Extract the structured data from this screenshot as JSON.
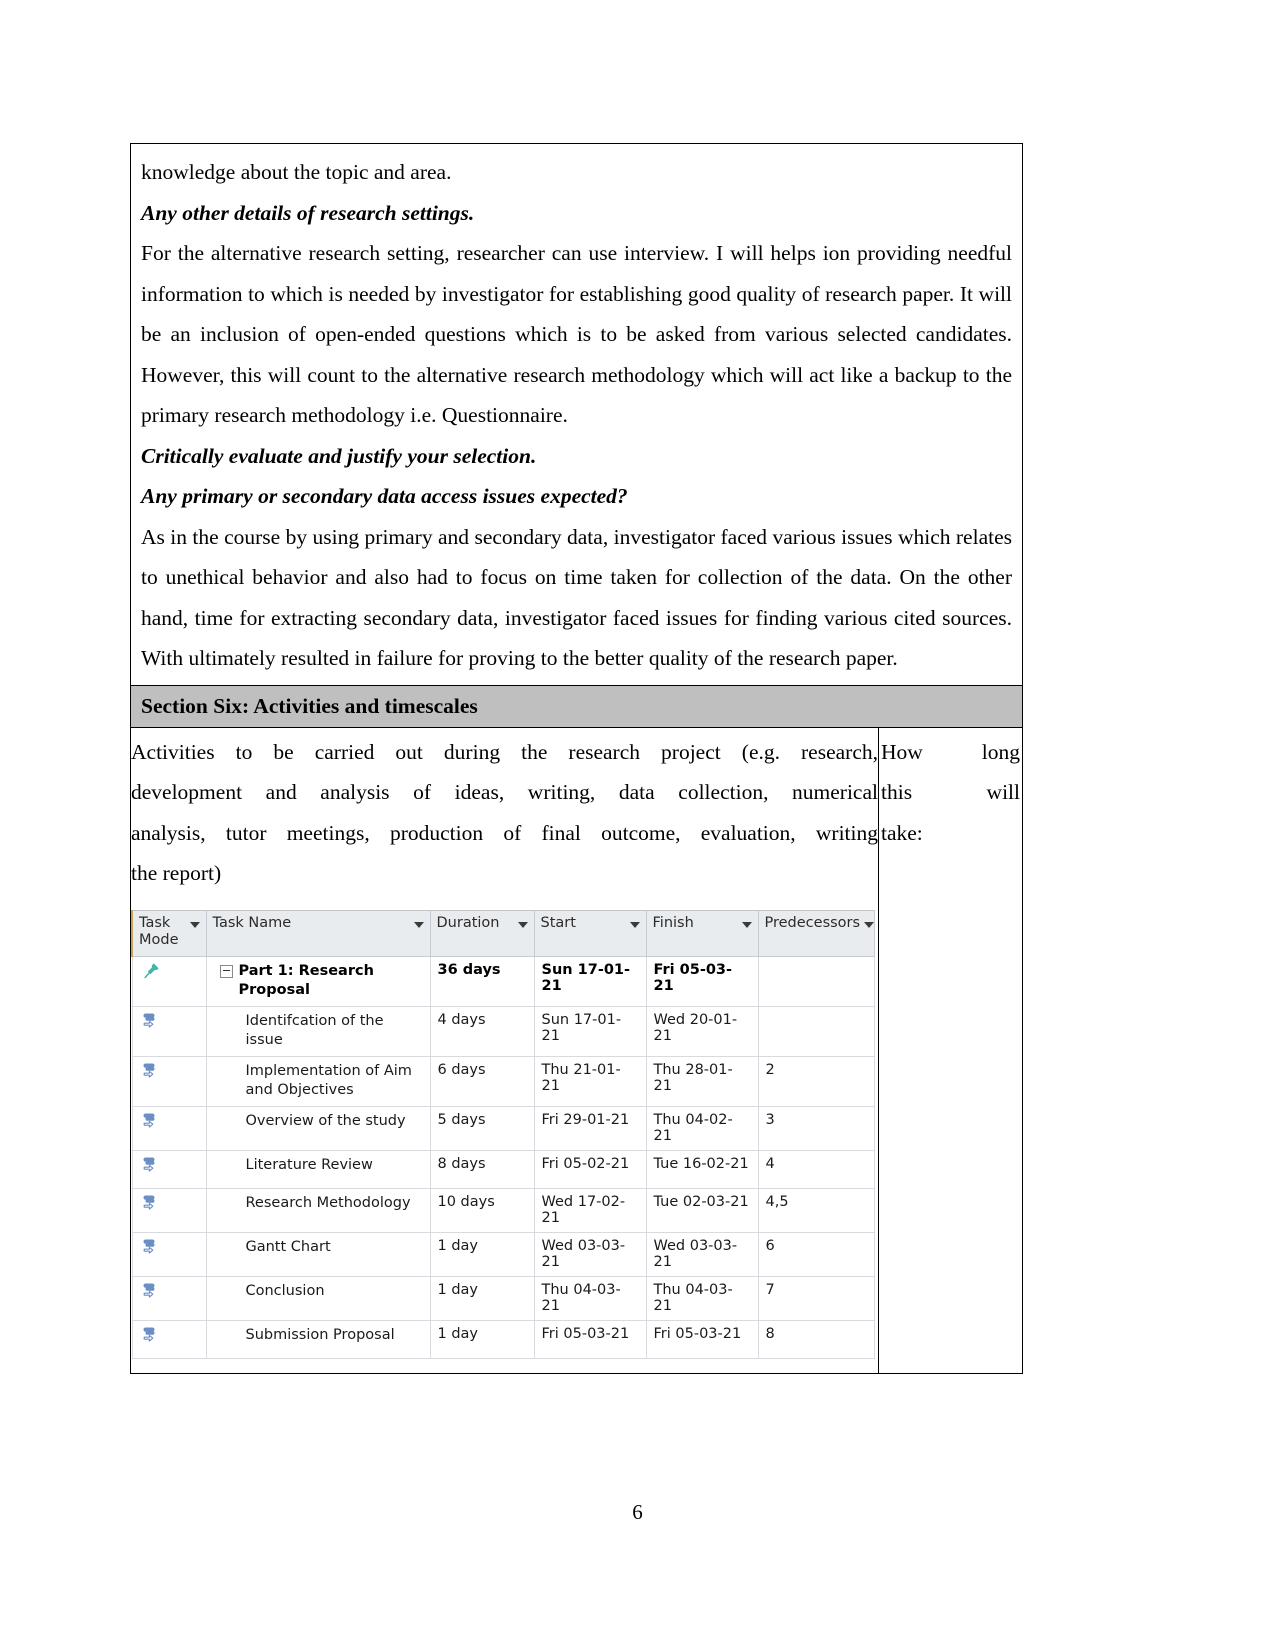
{
  "document": {
    "page_number": "6"
  },
  "prose": {
    "continuation_line": "knowledge about the topic and area.",
    "heading_1": "Any other details of research settings.",
    "paragraph_1": "For the alternative research setting, researcher can use interview. I will helps ion providing needful information to which is needed by investigator for establishing good quality of research paper. It will be an inclusion of open-ended questions which is to be asked from various selected candidates. However, this will count to the alternative research methodology which will act like a backup to the primary research methodology i.e. Questionnaire.",
    "heading_2": "Critically evaluate and justify your selection.",
    "heading_3": "Any primary or secondary data access issues expected?",
    "paragraph_2": "As in the course by using primary and secondary data, investigator faced various issues which relates to unethical behavior and also had to focus on time taken for collection of the data.  On the other hand, time for extracting secondary data, investigator faced issues for finding various cited sources. With ultimately resulted in failure for proving to the better quality of the research paper."
  },
  "section": {
    "band_title": "Section Six: Activities and timescales",
    "band_bg": "#bfbfbf",
    "left_column": {
      "line_1": "Activities to be carried out during the research project (e.g. research,",
      "line_2": "development and analysis of ideas, writing, data collection, numerical",
      "line_3": "analysis, tutor meetings, production of final outcome, evaluation, writing",
      "line_4": "the report)"
    },
    "right_column": {
      "line_1": "How long",
      "line_2": "this will",
      "line_3": "take:"
    }
  },
  "gantt_table": {
    "header_bg": "#e9ecef",
    "accent_border": "#c8a45c",
    "pin_color": "#3fb6ac",
    "auto_icon_color": "#6b8fc4",
    "columns": [
      {
        "key": "mode",
        "label": "Task Mode"
      },
      {
        "key": "name",
        "label": "Task Name"
      },
      {
        "key": "duration",
        "label": "Duration"
      },
      {
        "key": "start",
        "label": "Start"
      },
      {
        "key": "finish",
        "label": "Finish"
      },
      {
        "key": "predecessors",
        "label": "Predecessors"
      }
    ],
    "rows": [
      {
        "mode_icon": "pushpin-icon",
        "is_summary": true,
        "name": "Part 1: Research Proposal",
        "duration": "36 days",
        "start": "Sun 17-01-21",
        "finish": "Fri 05-03-21",
        "predecessors": ""
      },
      {
        "mode_icon": "auto-schedule-icon",
        "is_summary": false,
        "name": "Identifcation of the issue",
        "duration": "4 days",
        "start": "Sun 17-01-21",
        "finish": "Wed 20-01-21",
        "predecessors": ""
      },
      {
        "mode_icon": "auto-schedule-icon",
        "is_summary": false,
        "name": "Implementation of Aim and Objectives",
        "duration": "6 days",
        "start": "Thu 21-01-21",
        "finish": "Thu 28-01-21",
        "predecessors": "2"
      },
      {
        "mode_icon": "auto-schedule-icon",
        "is_summary": false,
        "name": "Overview of the study",
        "duration": "5 days",
        "start": "Fri 29-01-21",
        "finish": "Thu 04-02-21",
        "predecessors": "3"
      },
      {
        "mode_icon": "auto-schedule-icon",
        "is_summary": false,
        "name": "Literature Review",
        "duration": "8 days",
        "start": "Fri 05-02-21",
        "finish": "Tue 16-02-21",
        "predecessors": "4"
      },
      {
        "mode_icon": "auto-schedule-icon",
        "is_summary": false,
        "name": "Research Methodology",
        "duration": "10 days",
        "start": "Wed 17-02-21",
        "finish": "Tue 02-03-21",
        "predecessors": "4,5"
      },
      {
        "mode_icon": "auto-schedule-icon",
        "is_summary": false,
        "name": "Gantt Chart",
        "duration": "1 day",
        "start": "Wed 03-03-21",
        "finish": "Wed 03-03-21",
        "predecessors": "6"
      },
      {
        "mode_icon": "auto-schedule-icon",
        "is_summary": false,
        "name": "Conclusion",
        "duration": "1 day",
        "start": "Thu 04-03-21",
        "finish": "Thu 04-03-21",
        "predecessors": "7"
      },
      {
        "mode_icon": "auto-schedule-icon",
        "is_summary": false,
        "name": "Submission Proposal",
        "duration": "1 day",
        "start": "Fri 05-03-21",
        "finish": "Fri 05-03-21",
        "predecessors": "8"
      }
    ]
  }
}
